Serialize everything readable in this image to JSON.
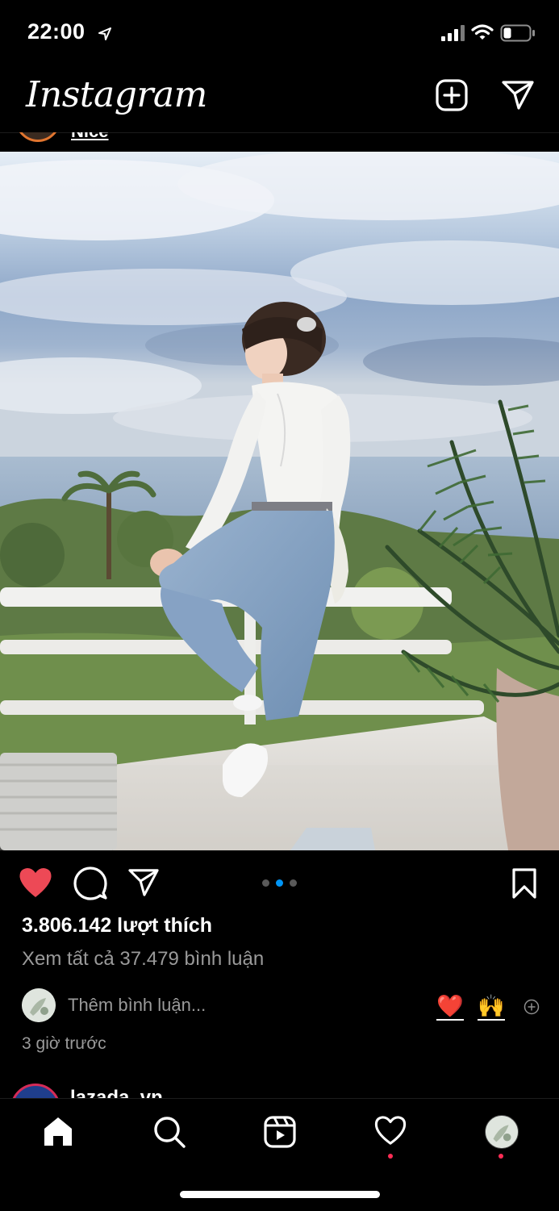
{
  "status_bar": {
    "time": "22:00",
    "icons": [
      "location-arrow-icon",
      "signal-icon",
      "wifi-icon",
      "battery-icon"
    ]
  },
  "header": {
    "logo": "Instagram",
    "icons": [
      "new-post-icon",
      "direct-message-icon"
    ]
  },
  "previous_post": {
    "caption_fragment": "Nice"
  },
  "post": {
    "carousel_dots": 3,
    "carousel_active_index": 1,
    "likes": "3.806.142 lượt thích",
    "view_all_comments": "Xem tất cả 37.479 bình luận",
    "add_comment_placeholder": "Thêm bình luận...",
    "quick_reactions": [
      "❤️",
      "🙌"
    ],
    "timestamp": "3 giờ trước",
    "colors": {
      "like_red": "#ed4956",
      "dot_active": "#0095f6",
      "dot_inactive": "#5a5a5a"
    }
  },
  "next_post": {
    "username_fragment": "lazada_vn"
  },
  "bottom_nav": {
    "items": [
      "home-icon",
      "search-icon",
      "reels-icon",
      "activity-icon",
      "profile-avatar"
    ],
    "notification_color": "#ff2d55"
  }
}
